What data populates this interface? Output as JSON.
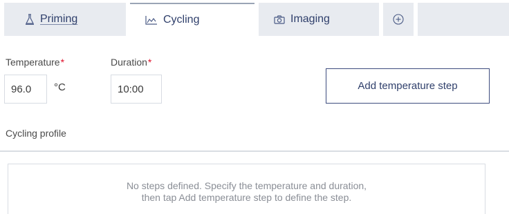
{
  "tabs": [
    {
      "label": "Priming",
      "icon": "flask-icon",
      "active": false
    },
    {
      "label": "Cycling",
      "icon": "graph-icon",
      "active": true
    },
    {
      "label": "Imaging",
      "icon": "camera-icon",
      "active": false
    }
  ],
  "add_tab_icon": "plus-circle-icon",
  "form": {
    "temperature": {
      "label": "Temperature",
      "required_mark": "*",
      "value": "96.0",
      "unit": "°C"
    },
    "duration": {
      "label": "Duration",
      "required_mark": "*",
      "value": "10:00"
    }
  },
  "add_step_button": "Add temperature step",
  "profile": {
    "title": "Cycling profile",
    "empty_line1": "No steps defined. Specify the temperature and duration,",
    "empty_line2": "then tap Add temperature step to define the step."
  },
  "colors": {
    "accent": "#2f3f6b",
    "required": "#e0102a",
    "tab_inactive_bg": "#e8ebf0"
  }
}
